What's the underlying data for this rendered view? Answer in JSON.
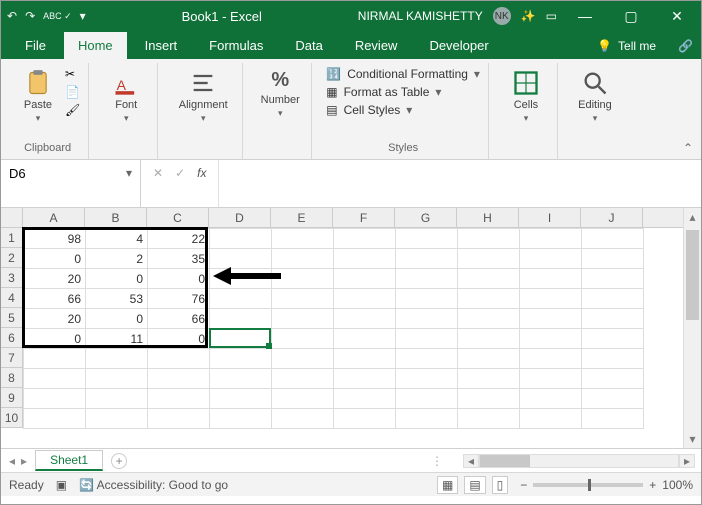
{
  "title": "Book1 - Excel",
  "user": {
    "name": "NIRMAL KAMISHETTY",
    "initials": "NK"
  },
  "qat": {
    "undo": "↶",
    "redo": "↷",
    "spell": "ABC ✓",
    "sep": "▾"
  },
  "win": {
    "min": "—",
    "max": "▢",
    "close": "✕"
  },
  "tabs": [
    "File",
    "Home",
    "Insert",
    "Formulas",
    "Data",
    "Review",
    "Developer"
  ],
  "active_tab": "Home",
  "tellme": "Tell me",
  "ribbon": {
    "clipboard": {
      "label": "Clipboard",
      "paste": "Paste"
    },
    "font": {
      "label": "Font"
    },
    "alignment": {
      "label": "Alignment"
    },
    "number": {
      "label": "Number",
      "pct": "%"
    },
    "styles": {
      "label": "Styles",
      "cond": "Conditional Formatting",
      "table": "Format as Table",
      "cell": "Cell Styles"
    },
    "cells": {
      "label": "Cells"
    },
    "editing": {
      "label": "Editing"
    }
  },
  "namebox": "D6",
  "fx": {
    "cancel": "✕",
    "enter": "✓",
    "fx": "fx",
    "value": ""
  },
  "columns": [
    "A",
    "B",
    "C",
    "D",
    "E",
    "F",
    "G",
    "H",
    "I",
    "J"
  ],
  "row_count": 10,
  "chart_data": {
    "type": "table",
    "title": "Sheet1 data A1:C6",
    "columns": [
      "A",
      "B",
      "C"
    ],
    "rows": [
      [
        98,
        4,
        22
      ],
      [
        0,
        2,
        35
      ],
      [
        20,
        0,
        0
      ],
      [
        66,
        53,
        76
      ],
      [
        20,
        0,
        66
      ],
      [
        0,
        11,
        0
      ]
    ]
  },
  "thick_range": "A1:C6",
  "selected_cell": "D6",
  "arrow_points_to": "C3",
  "sheet_tab": "Sheet1",
  "status": {
    "mode": "Ready",
    "acc": "Accessibility: Good to go",
    "zoom": "100%"
  }
}
